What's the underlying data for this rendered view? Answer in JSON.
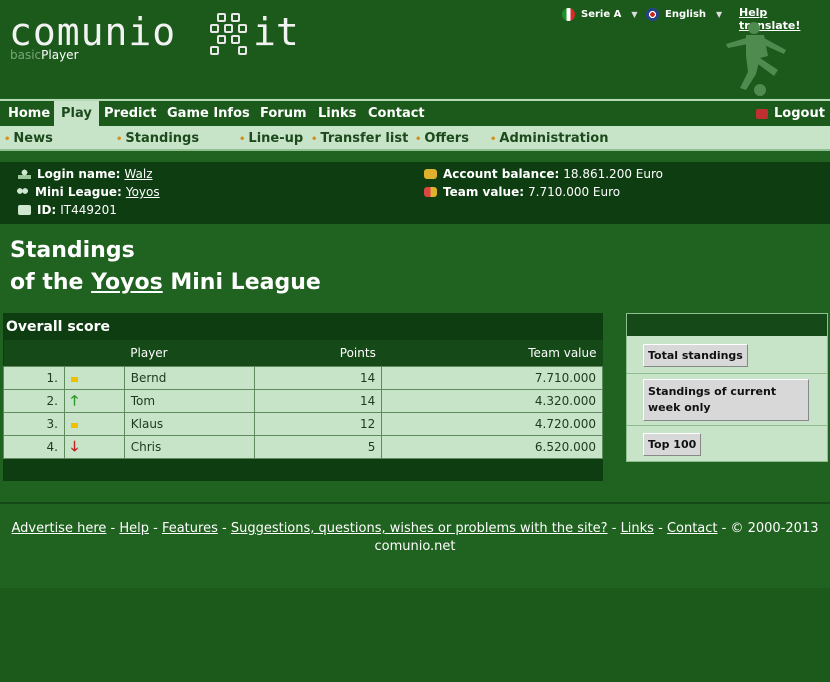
{
  "header": {
    "logo_main": "comunio",
    "logo_suffix": "it",
    "subtitle_part1": "basic",
    "subtitle_part2": "Player",
    "league_select": "Serie A",
    "language_select": "English",
    "help_translate": "Help translate!"
  },
  "nav": {
    "items": [
      "Home",
      "Play",
      "Predict",
      "Game Infos",
      "Forum",
      "Links",
      "Contact"
    ],
    "active": "Play",
    "logout": "Logout"
  },
  "subnav": {
    "items": [
      "News",
      "Standings",
      "Line-up",
      "Transfer list",
      "Offers",
      "Administration"
    ]
  },
  "info": {
    "login_label": "Login name:",
    "login_value": "Walz",
    "league_label": "Mini League:",
    "league_value": "Yoyos",
    "id_label": "ID:",
    "id_value": "IT449201",
    "balance_label": "Account balance:",
    "balance_value": "18.861.200 Euro",
    "teamvalue_label": "Team value:",
    "teamvalue_value": "7.710.000 Euro"
  },
  "title": {
    "line1": "Standings",
    "line2_prefix": "of the",
    "line2_link": "Yoyos",
    "line2_suffix": "Mini League"
  },
  "score": {
    "heading": "Overall score",
    "columns": {
      "player": "Player",
      "points": "Points",
      "team_value": "Team value"
    },
    "rows": [
      {
        "rank": "1.",
        "trend": "same",
        "player": "Bernd",
        "points": "14",
        "team_value": "7.710.000"
      },
      {
        "rank": "2.",
        "trend": "up",
        "player": "Tom",
        "points": "14",
        "team_value": "4.320.000"
      },
      {
        "rank": "3.",
        "trend": "same",
        "player": "Klaus",
        "points": "12",
        "team_value": "4.720.000"
      },
      {
        "rank": "4.",
        "trend": "down",
        "player": "Chris",
        "points": "5",
        "team_value": "6.520.000"
      }
    ]
  },
  "side": {
    "btn_total": "Total standings",
    "btn_week_line1": "Standings of current",
    "btn_week_line2": "week only",
    "btn_top100": "Top 100"
  },
  "footer": {
    "links": [
      "Advertise here",
      "Help",
      "Features",
      "Suggestions, questions, wishes or problems with the site?",
      "Links",
      "Contact"
    ],
    "copyright": "© 2000-2013",
    "domain": "comunio.net"
  },
  "colors": {
    "background": "#206220",
    "header": "#1c5a1c",
    "dark_panel": "#0f3d12",
    "light_panel": "#c8e4c8",
    "bullet": "#d6901a"
  },
  "icons": {
    "league_flag": "italy-flag-icon",
    "language_flag": "uk-flag-icon",
    "logout": "logout-icon",
    "user": "user-icon",
    "group": "group-icon",
    "id": "id-card-icon",
    "money": "money-icon",
    "team_value": "team-value-icon"
  }
}
